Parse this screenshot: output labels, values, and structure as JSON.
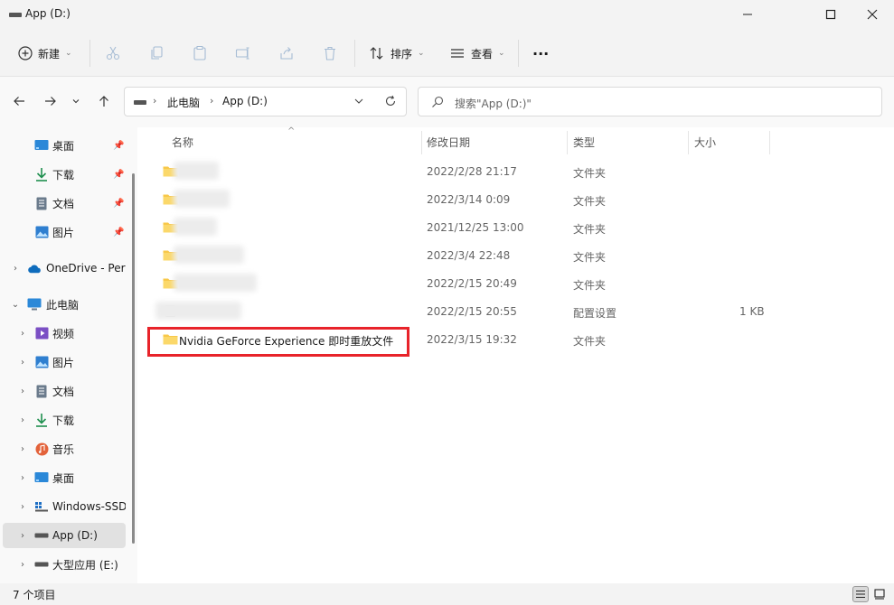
{
  "window": {
    "title": "App (D:)",
    "icon": "drive-icon",
    "controls": [
      "minimize-icon",
      "maximize-icon",
      "close-icon"
    ]
  },
  "toolbar": {
    "new_label": "新建",
    "sort_label": "排序",
    "view_label": "查看",
    "more_label": "···"
  },
  "nav": {
    "breadcrumb": [
      "此电脑",
      "App (D:)"
    ],
    "search_placeholder": "搜索\"App (D:)\""
  },
  "sidebar": {
    "quick_access": [
      {
        "label": "桌面",
        "icon": "desktop-icon",
        "pinned": true
      },
      {
        "label": "下载",
        "icon": "download-icon",
        "pinned": true
      },
      {
        "label": "文档",
        "icon": "document-icon",
        "pinned": true
      },
      {
        "label": "图片",
        "icon": "picture-icon",
        "pinned": true
      }
    ],
    "onedrive": {
      "label": "OneDrive - Pers",
      "icon": "cloud-icon"
    },
    "this_pc": {
      "label": "此电脑",
      "icon": "computer-icon"
    },
    "pc_items": [
      {
        "label": "视频",
        "icon": "video-icon"
      },
      {
        "label": "图片",
        "icon": "picture-icon"
      },
      {
        "label": "文档",
        "icon": "document-icon"
      },
      {
        "label": "下载",
        "icon": "download-icon"
      },
      {
        "label": "音乐",
        "icon": "music-icon"
      },
      {
        "label": "桌面",
        "icon": "desktop-icon"
      },
      {
        "label": "Windows-SSD",
        "icon": "windows-drive-icon"
      },
      {
        "label": "App (D:)",
        "icon": "drive-icon",
        "selected": true
      },
      {
        "label": "大型应用 (E:)",
        "icon": "drive-icon"
      }
    ]
  },
  "columns": {
    "name": "名称",
    "modified": "修改日期",
    "type": "类型",
    "size": "大小"
  },
  "rows": [
    {
      "name": "",
      "modified": "2022/2/28 21:17",
      "type": "文件夹",
      "size": "",
      "icon": "folder-icon"
    },
    {
      "name": "",
      "modified": "2022/3/14 0:09",
      "type": "文件夹",
      "size": "",
      "icon": "folder-icon"
    },
    {
      "name": "",
      "modified": "2021/12/25 13:00",
      "type": "文件夹",
      "size": "",
      "icon": "folder-icon"
    },
    {
      "name": "",
      "modified": "2022/3/4 22:48",
      "type": "文件夹",
      "size": "",
      "icon": "folder-icon"
    },
    {
      "name": "",
      "modified": "2022/2/15 20:49",
      "type": "文件夹",
      "size": "",
      "icon": "folder-icon"
    },
    {
      "name": "",
      "modified": "2022/2/15 20:55",
      "type": "配置设置",
      "size": "1 KB",
      "icon": "settings-file-icon"
    },
    {
      "name": "Nvidia GeForce Experience 即时重放文件",
      "modified": "2022/3/15 19:32",
      "type": "文件夹",
      "size": "",
      "icon": "folder-icon"
    }
  ],
  "status": {
    "item_count": "7 个项目"
  },
  "colors": {
    "highlight": "#e8232a",
    "folder": "#f8c84a",
    "selection": "#e1e1e1"
  }
}
